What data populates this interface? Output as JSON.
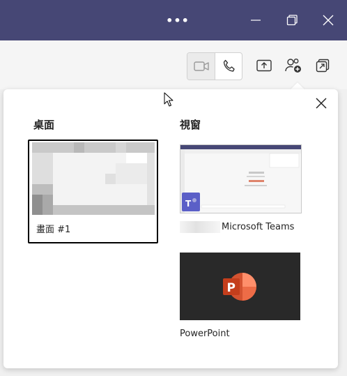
{
  "titlebar": {
    "more_label": "•••",
    "controls": [
      "minimize-icon",
      "restore-icon",
      "close-icon"
    ]
  },
  "toolbar": {
    "buttons": [
      "video-call-icon",
      "audio-call-icon",
      "share-tray-icon",
      "people-add-icon",
      "popout-icon"
    ]
  },
  "share_panel": {
    "desktop_heading": "桌面",
    "window_heading": "視窗",
    "screens": [
      {
        "label": "畫面 #1",
        "selected": true
      }
    ],
    "windows": [
      {
        "label": "Microsoft Teams",
        "icon": "teams-icon"
      },
      {
        "label": "PowerPoint",
        "icon": "powerpoint-icon"
      }
    ]
  },
  "colors": {
    "titlebar": "#464775",
    "powerpoint_orange": "#d35230",
    "teams_purple": "#5b5fc7"
  }
}
